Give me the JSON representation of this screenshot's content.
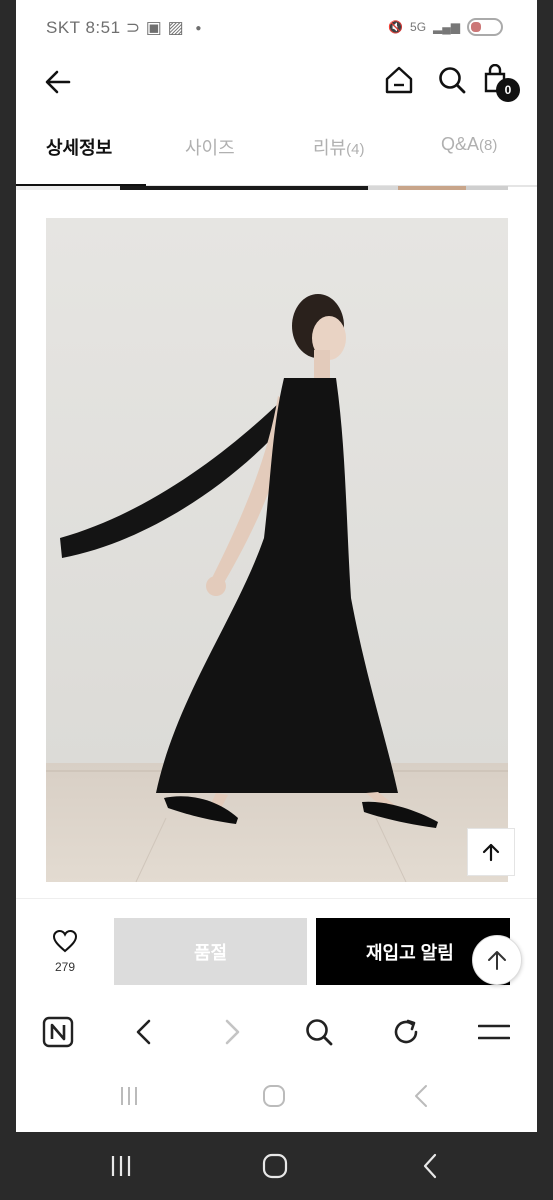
{
  "status_bar": {
    "carrier_time": "SKT 8:51",
    "network": "5G"
  },
  "header": {
    "back_icon": "arrow-left-icon",
    "home_icon": "home-icon",
    "search_icon": "search-icon",
    "cart_icon": "shopping-bag-icon",
    "cart_count": "0"
  },
  "tabs": [
    {
      "label": "상세정보",
      "active": true
    },
    {
      "label": "사이즈",
      "active": false
    },
    {
      "label": "리뷰",
      "count": "(4)",
      "active": false
    },
    {
      "label": "Q&A",
      "count": "(8)",
      "active": false
    }
  ],
  "action_bar": {
    "like_count": "279",
    "soldout_label": "품절",
    "restock_label": "재입고 알림"
  },
  "colors": {
    "accent": "#000000",
    "disabled": "#dcdcdc",
    "tab_inactive": "#b0b0b0"
  }
}
